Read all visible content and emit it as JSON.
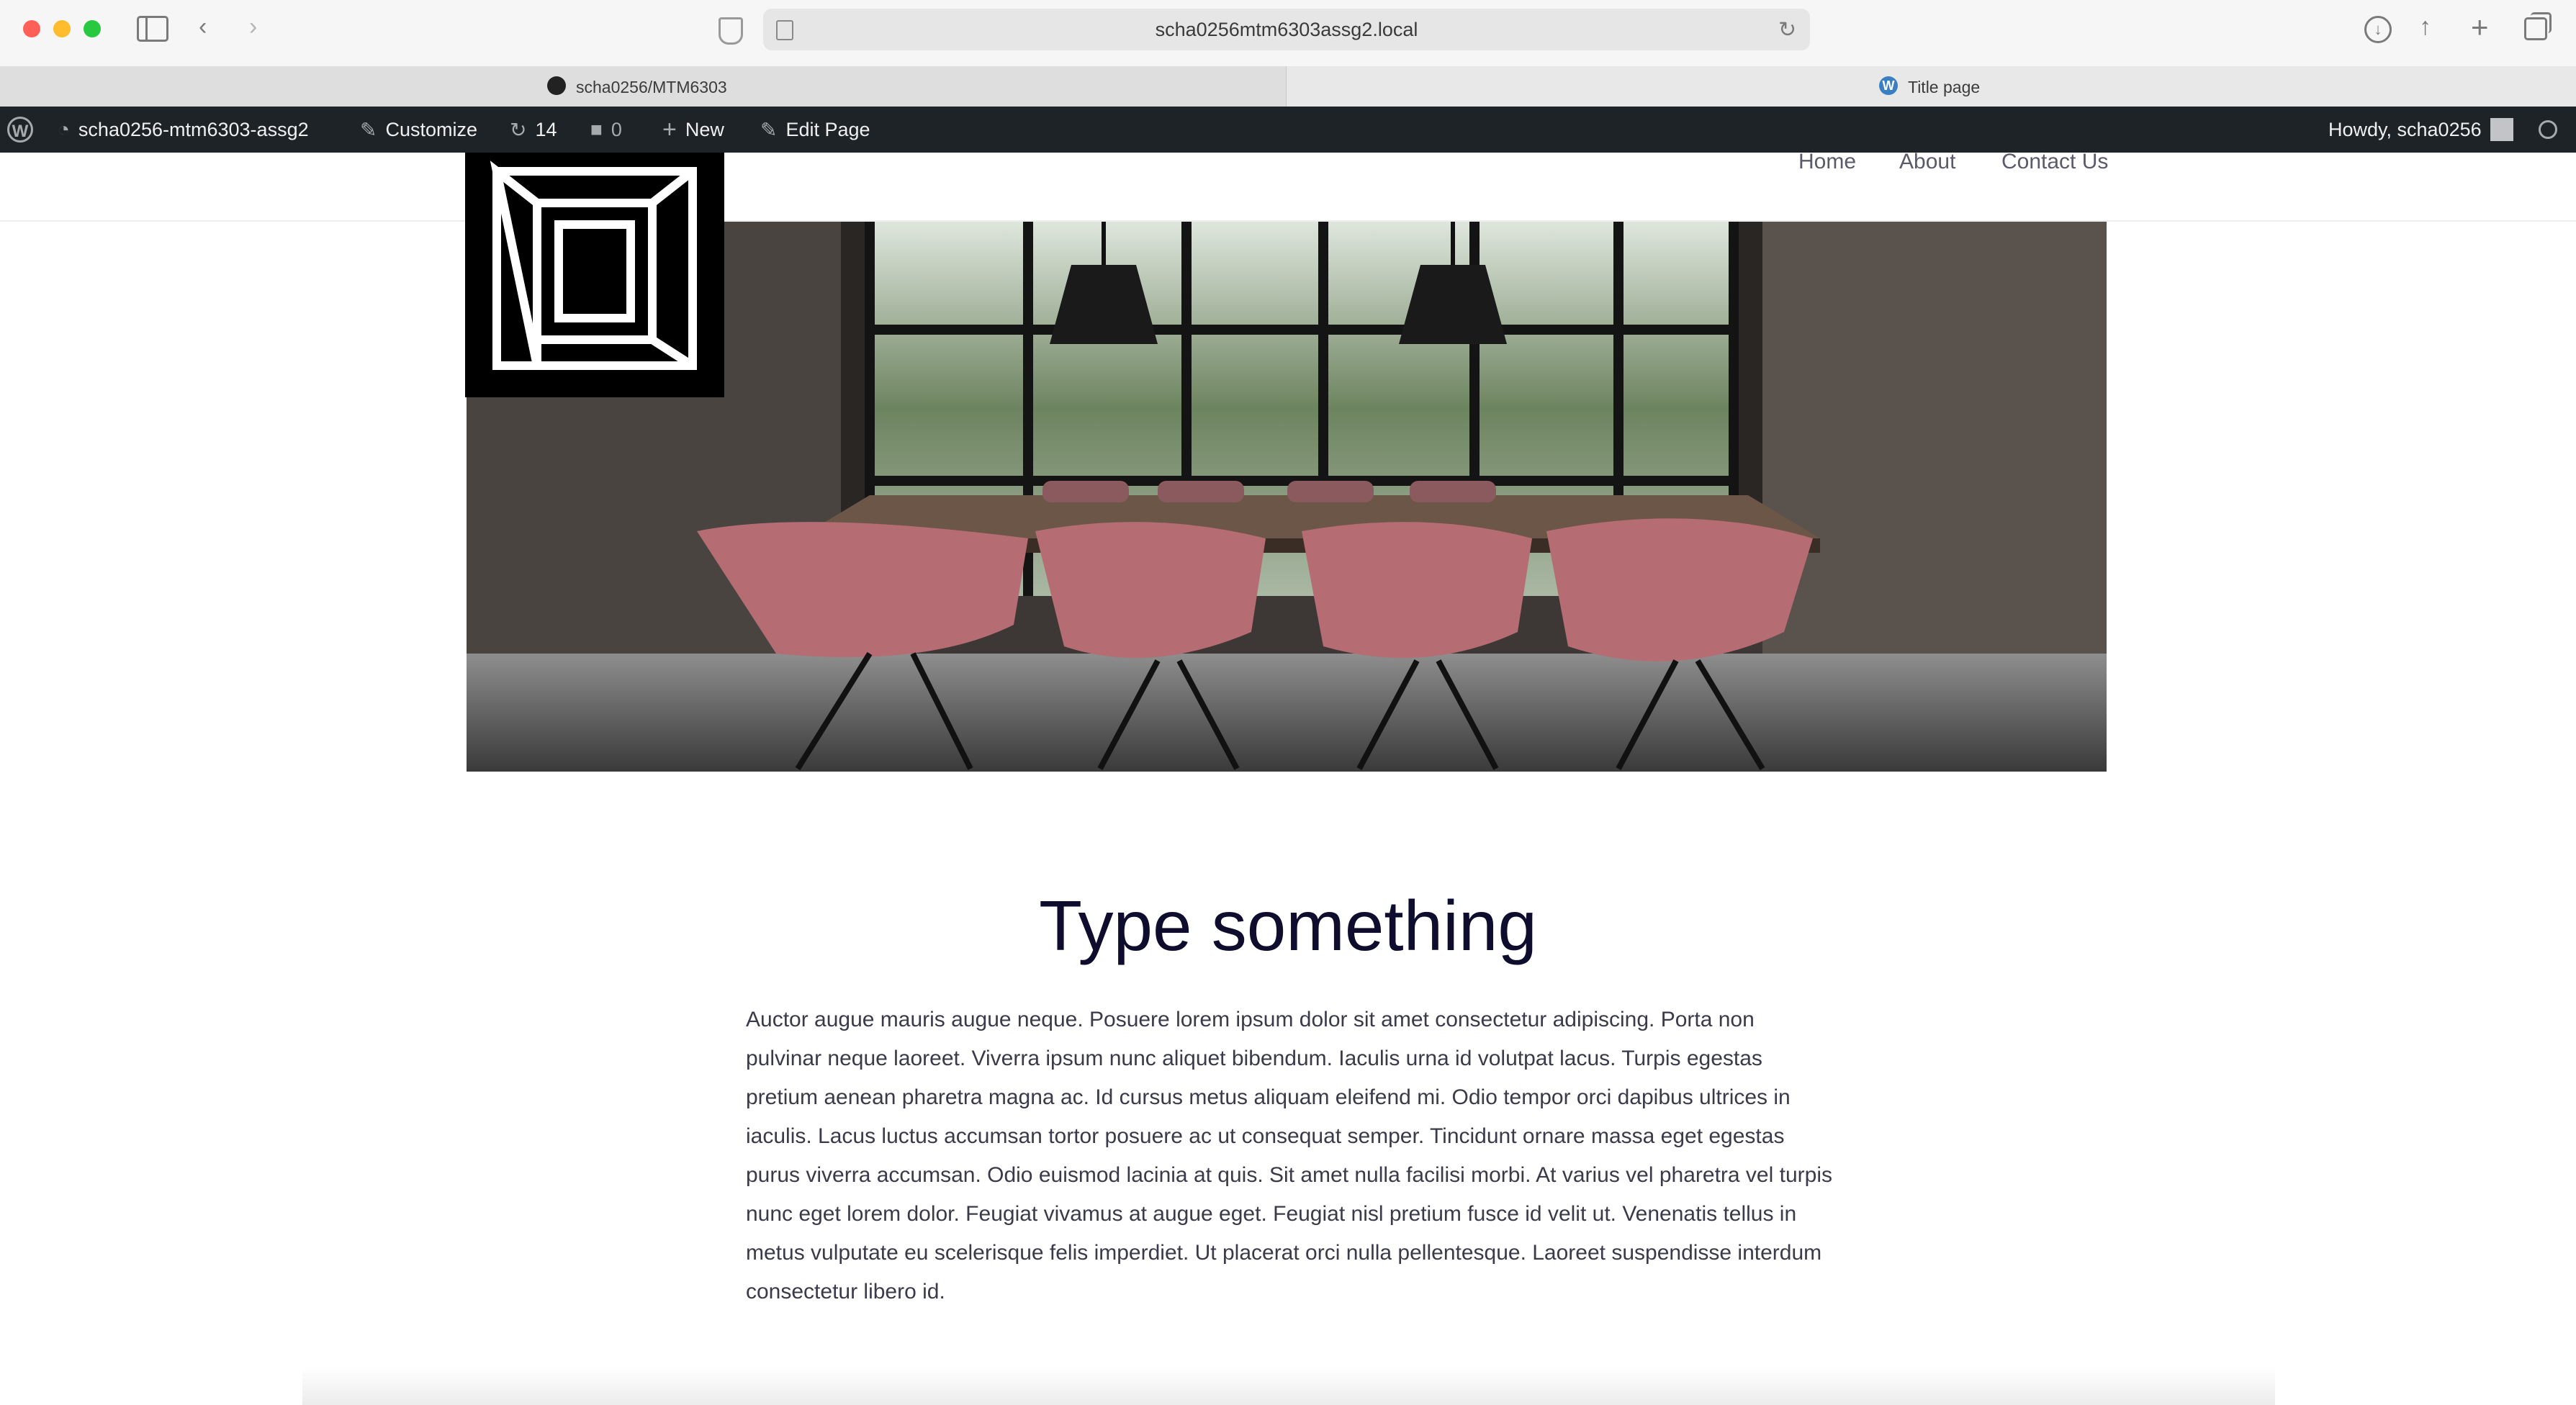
{
  "browser": {
    "url": "scha0256mtm6303assg2.local",
    "tabs": [
      {
        "label": "scha0256/MTM6303",
        "icon": "github-icon"
      },
      {
        "label": "Title page",
        "icon": "wordpress-icon"
      }
    ]
  },
  "admin_bar": {
    "site_name": "scha0256-mtm6303-assg2",
    "customize": "Customize",
    "updates_count": "14",
    "comments_count": "0",
    "new_label": "New",
    "edit_page": "Edit Page",
    "howdy": "Howdy, scha0256"
  },
  "nav": {
    "items": [
      "Home",
      "About",
      "Contact Us"
    ]
  },
  "content": {
    "heading": "Type something",
    "paragraph": "Auctor augue mauris augue neque. Posuere lorem ipsum dolor sit amet consectetur adipiscing. Porta non pulvinar neque laoreet. Viverra ipsum nunc aliquet bibendum. Iaculis urna id volutpat lacus. Turpis egestas pretium aenean pharetra magna ac. Id cursus metus aliquam eleifend mi. Odio tempor orci dapibus ultrices in iaculis. Lacus luctus accumsan tortor posuere ac ut consequat semper. Tincidunt ornare massa eget egestas purus viverra accumsan. Odio euismod lacinia at quis. Sit amet nulla facilisi morbi. At varius vel pharetra vel turpis nunc eget lorem dolor. Feugiat vivamus at augue eget. Feugiat nisl pretium fusce id velit ut. Venenatis tellus in metus vulputate eu scelerisque felis imperdiet. Ut placerat orci nulla pellentesque. Laoreet suspendisse interdum consectetur libero id."
  },
  "colors": {
    "admin_bar_bg": "#1d2327",
    "heading": "#0f0d2e",
    "body_text": "#3a3a4a",
    "chair": "#b56c72"
  }
}
